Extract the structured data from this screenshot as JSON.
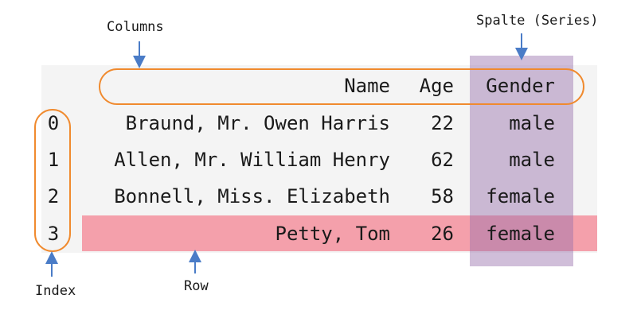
{
  "labels": {
    "columns": "Columns",
    "series": "Spalte (Series)",
    "index": "Index",
    "row": "Row"
  },
  "table": {
    "headers": [
      "Name",
      "Age",
      "Gender"
    ],
    "rows": [
      {
        "index": "0",
        "name": "Braund, Mr. Owen Harris",
        "age": "22",
        "gender": "male"
      },
      {
        "index": "1",
        "name": "Allen, Mr. William Henry",
        "age": "62",
        "gender": "male"
      },
      {
        "index": "2",
        "name": "Bonnell, Miss. Elizabeth",
        "age": "58",
        "gender": "female"
      },
      {
        "index": "3",
        "name": "Petty, Tom",
        "age": "26",
        "gender": "female"
      }
    ]
  },
  "colors": {
    "oval": "#f08a2e",
    "arrow": "#4a7cc7",
    "row_highlight": "#f4a0ab",
    "column_highlight": "#a88bb8",
    "panel": "#f4f4f4"
  }
}
